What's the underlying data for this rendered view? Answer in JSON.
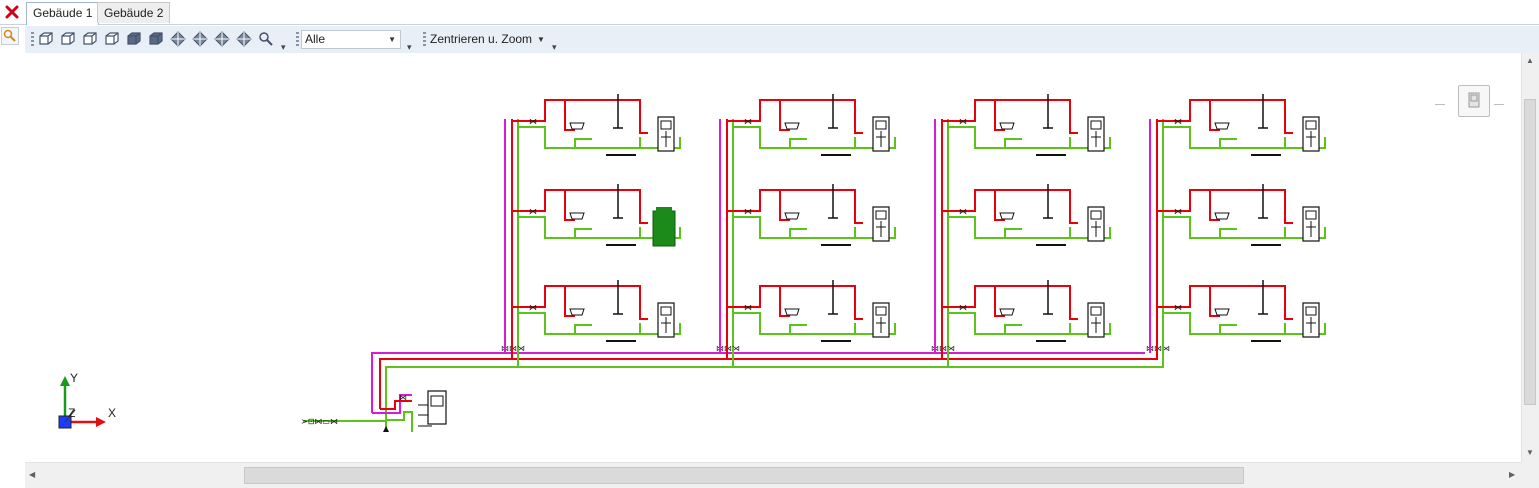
{
  "tabs": [
    {
      "label": "Gebäude 1",
      "active": true
    },
    {
      "label": "Gebäude 2",
      "active": false
    }
  ],
  "toolbar": {
    "view_buttons": [
      "view-back-icon",
      "view-front-icon",
      "view-left-icon",
      "view-right-icon",
      "view-top-icon",
      "view-bottom-icon",
      "iso-sw-icon",
      "iso-se-icon",
      "iso-ne-icon",
      "iso-nw-icon",
      "zoom-window-icon"
    ],
    "filter_value": "Alle",
    "zoom_mode": "Zentrieren u. Zoom"
  },
  "axes": {
    "x_label": "X",
    "y_label": "Y",
    "z_label": "Z"
  },
  "colors": {
    "hot_water": "#e8000b",
    "cold_water": "#5cc31a",
    "circulation": "#d81bd8",
    "selected_fixture": "#1b8a1b",
    "toolbar_bg": "#e9eff7"
  }
}
